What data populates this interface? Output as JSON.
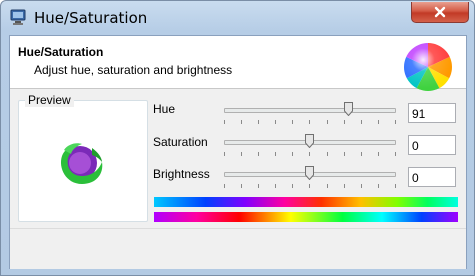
{
  "window": {
    "title": "Hue/Saturation",
    "icon": "monitor-app-icon",
    "close_icon": "close-icon"
  },
  "header": {
    "title": "Hue/Saturation",
    "subtitle": "Adjust hue, saturation and brightness",
    "icon": "color-sphere-icon"
  },
  "preview": {
    "label": "Preview",
    "image": "firefox-logo-icon"
  },
  "controls": {
    "hue": {
      "label": "Hue",
      "value": "91",
      "slider_fraction": 0.74
    },
    "saturation": {
      "label": "Saturation",
      "value": "0",
      "slider_fraction": 0.5
    },
    "brightness": {
      "label": "Brightness",
      "value": "0",
      "slider_fraction": 0.5
    }
  },
  "colors": {
    "close_button": "#c7402c",
    "title_bar": "#b9d0e8"
  }
}
